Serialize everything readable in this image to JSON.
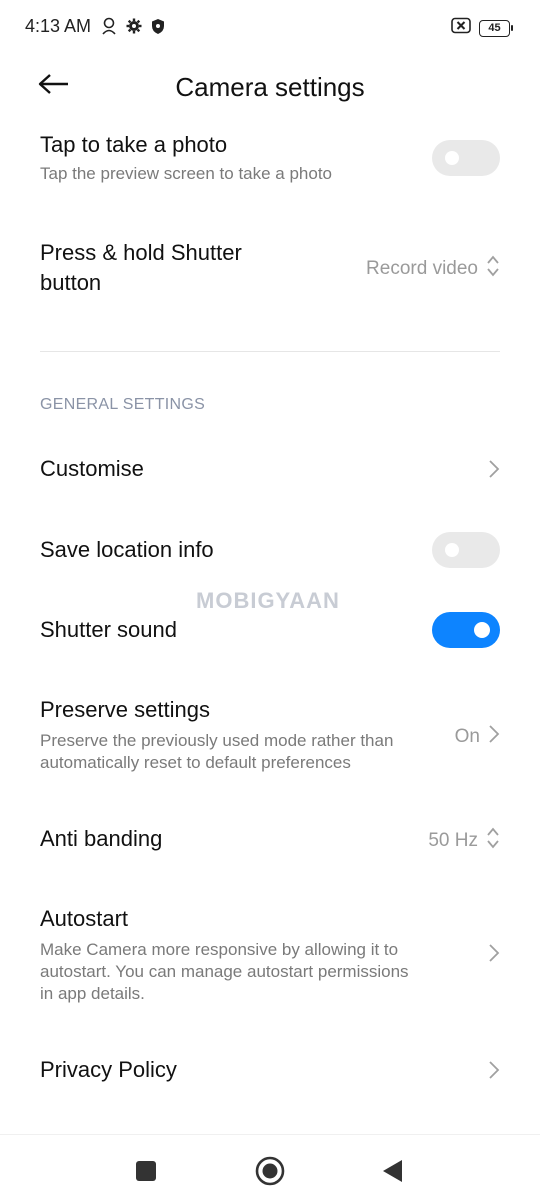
{
  "status_bar": {
    "time": "4:13 AM",
    "battery": "45"
  },
  "header": {
    "title": "Camera settings"
  },
  "rows": {
    "tap_photo": {
      "title": "Tap to take a photo",
      "subtitle": "Tap the preview screen to take a photo",
      "toggle_on": false
    },
    "press_hold": {
      "title_line1": "Press & hold Shutter",
      "title_line2": "button",
      "value": "Record video"
    },
    "customise": {
      "title": "Customise"
    },
    "save_location": {
      "title": "Save location info",
      "toggle_on": false
    },
    "shutter_sound": {
      "title": "Shutter sound",
      "toggle_on": true
    },
    "preserve": {
      "title": "Preserve settings",
      "subtitle_line1": "Preserve the previously used mode rather than",
      "subtitle_line2": "automatically reset to default preferences",
      "value": "On"
    },
    "anti_banding": {
      "title": "Anti banding",
      "value": "50 Hz"
    },
    "autostart": {
      "title": "Autostart",
      "subtitle_line1": "Make Camera more responsive by allowing it to",
      "subtitle_line2": "autostart. You can manage autostart permissions",
      "subtitle_line3": "in app details."
    },
    "privacy": {
      "title": "Privacy Policy"
    }
  },
  "section": {
    "general": "GENERAL SETTINGS"
  },
  "watermark": "MOBIGYAAN",
  "colors": {
    "accent": "#0d84ff",
    "toggle_off": "#e9e9e9",
    "secondary_text": "#7a7a7a",
    "section_text": "#8a93a6"
  },
  "icons": {
    "back": "back-arrow-icon",
    "chevron": "chevron-right-icon",
    "updown": "up-down-arrows-icon",
    "nav_recent": "square-icon",
    "nav_home": "circle-icon",
    "nav_back": "triangle-back-icon"
  }
}
